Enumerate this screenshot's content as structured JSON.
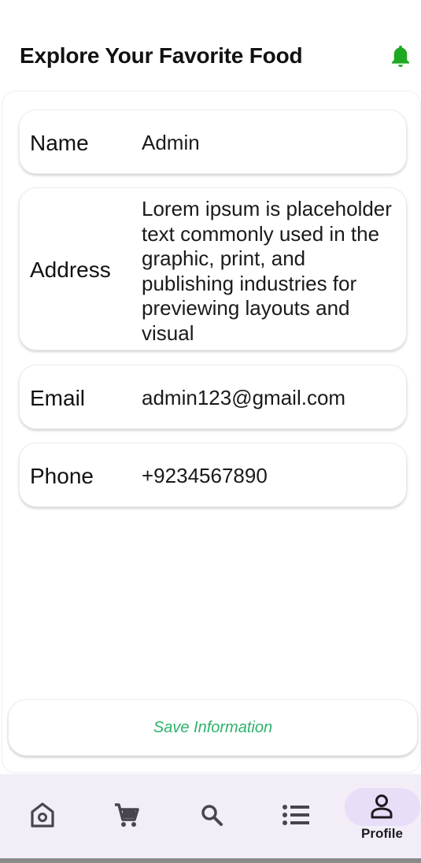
{
  "header": {
    "title": "Explore Your Favorite Food",
    "bell_icon": "bell-icon",
    "accent_color": "#1fa821"
  },
  "profile": {
    "fields": [
      {
        "label": "Name",
        "value": "Admin"
      },
      {
        "label": "Address",
        "value": "Lorem ipsum is placeholder text commonly used in the graphic, print, and publishing industries for previewing layouts and visual"
      },
      {
        "label": "Email",
        "value": "admin123@gmail.com"
      },
      {
        "label": "Phone",
        "value": "+9234567890"
      }
    ],
    "save_label": "Save Information",
    "save_color": "#2db36b"
  },
  "nav": {
    "items": [
      {
        "icon": "home-icon",
        "label": ""
      },
      {
        "icon": "cart-icon",
        "label": ""
      },
      {
        "icon": "search-icon",
        "label": ""
      },
      {
        "icon": "list-icon",
        "label": ""
      },
      {
        "icon": "person-icon",
        "label": "Profile",
        "selected": true
      }
    ]
  }
}
